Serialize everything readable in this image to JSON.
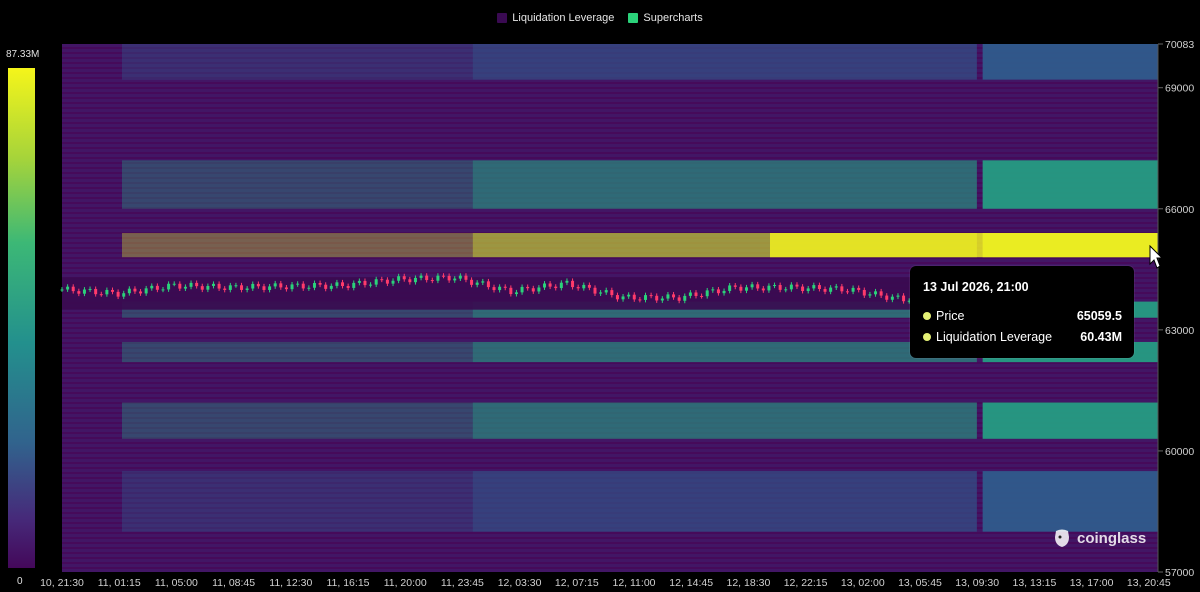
{
  "legend": [
    {
      "label": "Liquidation Leverage",
      "color": "#3a0a52"
    },
    {
      "label": "Supercharts",
      "color": "#2bd27a"
    }
  ],
  "color_scale": {
    "max_label": "87.33M",
    "min_label": "0"
  },
  "tooltip": {
    "title": "13 Jul 2026, 21:00",
    "rows": [
      {
        "label": "Price",
        "value": "65059.5"
      },
      {
        "label": "Liquidation Leverage",
        "value": "60.43M"
      }
    ]
  },
  "watermark": "coinglass",
  "chart_data": {
    "type": "heatmap",
    "title": "",
    "xlabel": "",
    "ylabel": "",
    "ylim": [
      57000,
      70083
    ],
    "y_ticks": [
      "70083",
      "69000",
      "66000",
      "63000",
      "60000",
      "57000"
    ],
    "x_ticks": [
      "10, 21:30",
      "11, 01:15",
      "11, 05:00",
      "11, 08:45",
      "11, 12:30",
      "11, 16:15",
      "11, 20:00",
      "11, 23:45",
      "12, 03:30",
      "12, 07:15",
      "12, 11:00",
      "12, 14:45",
      "12, 18:30",
      "12, 22:15",
      "13, 02:00",
      "13, 05:45",
      "13, 09:30",
      "13, 13:15",
      "13, 17:00",
      "13, 20:45"
    ],
    "colorbar": {
      "min": 0,
      "max": "87.33M"
    },
    "price_series": {
      "name": "Supercharts",
      "x": [
        "10, 21:30",
        "11, 01:15",
        "11, 05:00",
        "11, 08:45",
        "11, 12:30",
        "11, 16:15",
        "11, 20:00",
        "11, 23:45",
        "12, 03:30",
        "12, 07:15",
        "12, 11:00",
        "12, 14:45",
        "12, 18:30",
        "12, 22:15",
        "13, 02:00",
        "13, 05:45",
        "13, 09:30",
        "13, 13:15",
        "13, 17:00",
        "13, 20:45"
      ],
      "close": [
        64000,
        63900,
        64100,
        64050,
        64080,
        64100,
        64250,
        64300,
        63950,
        64150,
        63800,
        63800,
        64050,
        64050,
        64000,
        63750,
        64100,
        64300,
        63400,
        63200
      ]
    },
    "liquidation_bands": [
      {
        "price_low": 69200,
        "price_high": 70083,
        "level": "low"
      },
      {
        "price_low": 66000,
        "price_high": 67200,
        "level": "medium"
      },
      {
        "price_low": 64800,
        "price_high": 65400,
        "level": "high"
      },
      {
        "price_low": 63300,
        "price_high": 63700,
        "level": "medium"
      },
      {
        "price_low": 62200,
        "price_high": 62700,
        "level": "medium"
      },
      {
        "price_low": 60300,
        "price_high": 61200,
        "level": "medium"
      },
      {
        "price_low": 58000,
        "price_high": 59500,
        "level": "low"
      }
    ],
    "legend_position": "top-center"
  }
}
